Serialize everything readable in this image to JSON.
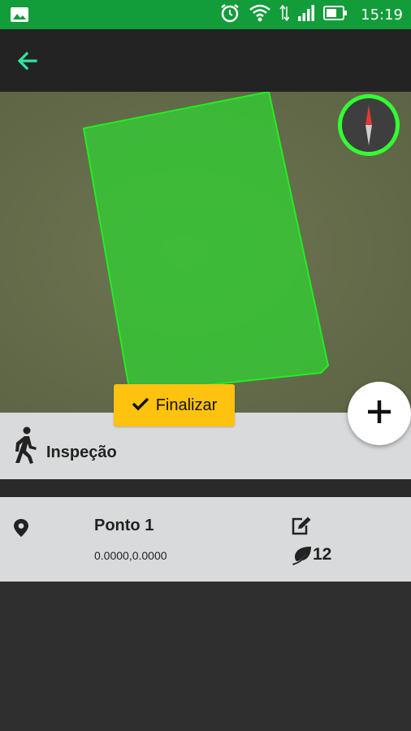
{
  "status_bar": {
    "time": "15:19",
    "icons": [
      "gallery-icon",
      "alarm-icon",
      "wifi-icon",
      "data-arrows-icon",
      "signal-icon",
      "battery-icon"
    ]
  },
  "app_bar": {
    "back_icon": "arrow-left-icon",
    "accent_color": "#2ee6a0"
  },
  "map": {
    "field_color": "#33cc33",
    "compass_ring_color": "#33ff33"
  },
  "finalize_button": {
    "label": "Finalizar",
    "icon": "check-icon",
    "color": "#ffc20e"
  },
  "add_button": {
    "icon": "plus-icon"
  },
  "inspection": {
    "icon": "walking-person-icon",
    "label": "Inspeção"
  },
  "points": [
    {
      "name": "Ponto 1",
      "coords": "0.0000,0.0000",
      "count": "12",
      "icons": [
        "location-pin-icon",
        "edit-icon",
        "leaf-icon"
      ]
    }
  ]
}
